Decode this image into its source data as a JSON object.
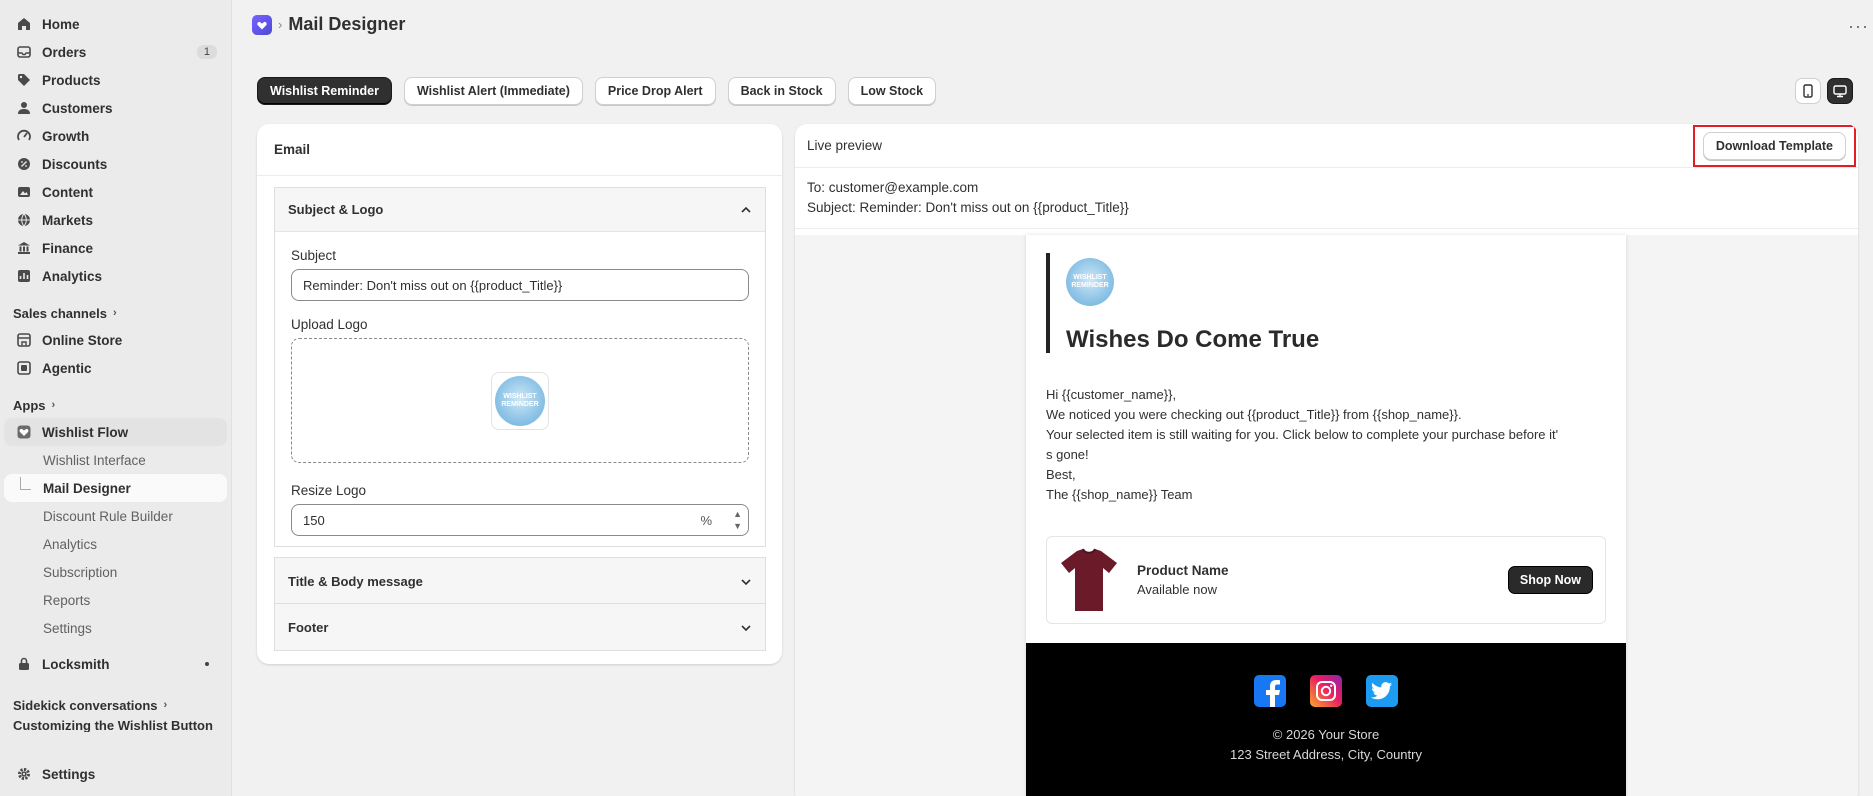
{
  "sidebar": {
    "items": [
      {
        "label": "Home",
        "icon": "home-icon"
      },
      {
        "label": "Orders",
        "icon": "orders-icon",
        "badge": "1"
      },
      {
        "label": "Products",
        "icon": "tag-icon"
      },
      {
        "label": "Customers",
        "icon": "person-icon"
      },
      {
        "label": "Growth",
        "icon": "growth-icon"
      },
      {
        "label": "Discounts",
        "icon": "discount-icon"
      },
      {
        "label": "Content",
        "icon": "content-icon"
      },
      {
        "label": "Markets",
        "icon": "globe-icon"
      },
      {
        "label": "Finance",
        "icon": "bank-icon"
      },
      {
        "label": "Analytics",
        "icon": "chart-icon"
      }
    ],
    "sales_channels_label": "Sales channels",
    "channels": [
      {
        "label": "Online Store",
        "icon": "store-icon"
      },
      {
        "label": "Agentic",
        "icon": "agentic-icon"
      }
    ],
    "apps_label": "Apps",
    "app_name": "Wishlist Flow",
    "app_subitems": [
      "Wishlist Interface",
      "Mail Designer",
      "Discount Rule Builder",
      "Analytics",
      "Subscription",
      "Reports",
      "Settings"
    ],
    "locksmith": "Locksmith",
    "sidekick_label": "Sidekick conversations",
    "sidekick_item": "Customizing the Wishlist Button",
    "settings": "Settings"
  },
  "header": {
    "title": "Mail Designer"
  },
  "tabs": [
    "Wishlist Reminder",
    "Wishlist Alert (Immediate)",
    "Price Drop Alert",
    "Back in Stock",
    "Low Stock"
  ],
  "email_card": {
    "title": "Email",
    "subject_logo_section": "Subject & Logo",
    "subject_label": "Subject",
    "subject_value": "Reminder: Don't miss out on {{product_Title}}",
    "upload_logo_label": "Upload Logo",
    "logo_text": "WISHLIST REMINDER",
    "resize_logo_label": "Resize Logo",
    "resize_logo_value": "150",
    "resize_suffix": "%",
    "title_body_section": "Title & Body message",
    "footer_section": "Footer"
  },
  "preview": {
    "title": "Live preview",
    "download_label": "Download Template",
    "to_line": "To: customer@example.com",
    "subject_line": "Subject: Reminder: Don't miss out on {{product_Title}}",
    "hero_title": "Wishes Do Come True",
    "body_lines": [
      "Hi {{customer_name}},",
      "We noticed you were checking out {{product_Title}} from {{shop_name}}.",
      "Your selected item is still waiting for you. Click below to complete your purchase before it'",
      "s gone!",
      "Best,",
      "The {{shop_name}} Team"
    ],
    "product_name": "Product Name",
    "product_status": "Available now",
    "shop_button": "Shop Now",
    "footer_copyright": "© 2026 Your Store",
    "footer_address": "123 Street Address, City, Country"
  },
  "colors": {
    "accent_dark": "#303030",
    "highlight_red": "#e01e28",
    "facebook": "#1877f2",
    "twitter": "#1d9bf0"
  }
}
